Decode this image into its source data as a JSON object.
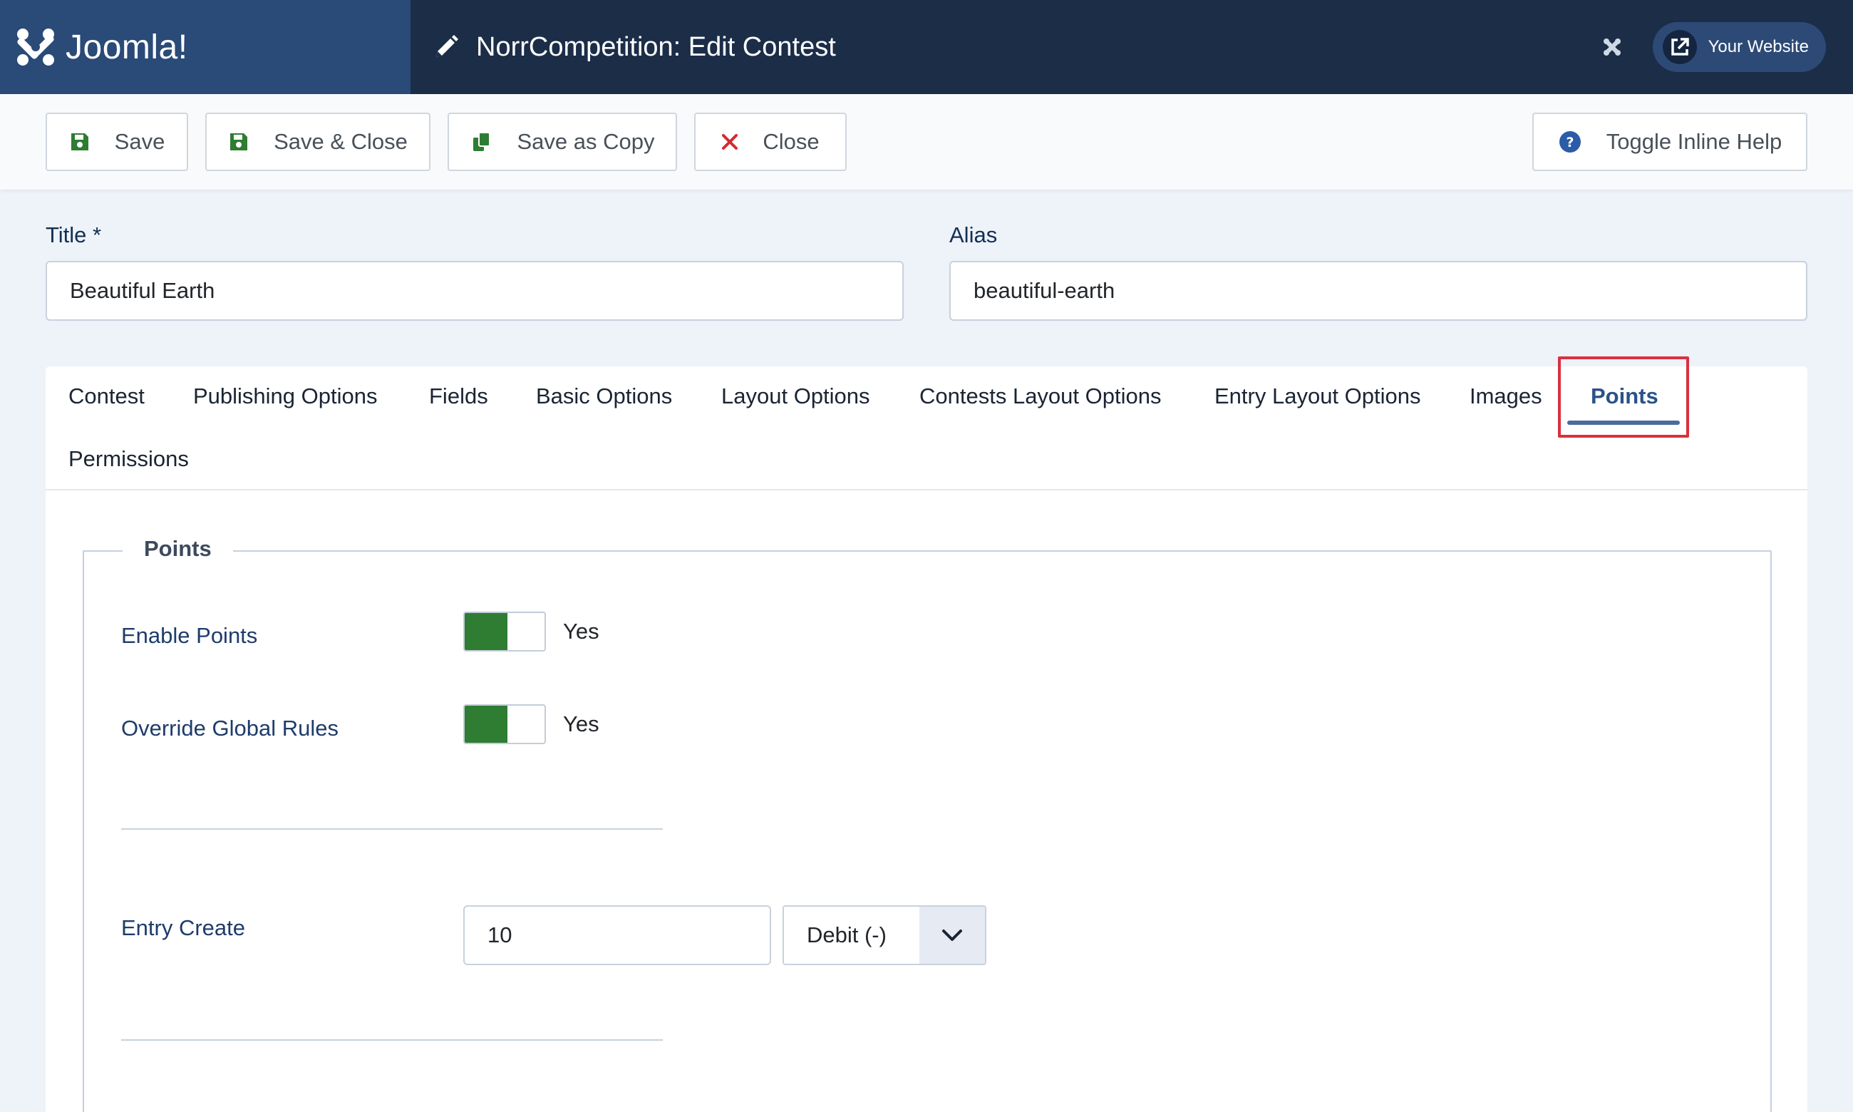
{
  "header": {
    "logo_text": "Joomla!",
    "page_title": "NorrCompetition: Edit Contest",
    "site_button_label": "Your Website"
  },
  "toolbar": {
    "save_label": "Save",
    "save_close_label": "Save & Close",
    "save_copy_label": "Save as Copy",
    "close_label": "Close",
    "help_label": "Toggle Inline Help"
  },
  "form": {
    "title_label": "Title *",
    "title_value": "Beautiful Earth",
    "alias_label": "Alias",
    "alias_value": "beautiful-earth"
  },
  "tabs": [
    {
      "label": "Contest"
    },
    {
      "label": "Publishing Options"
    },
    {
      "label": "Fields"
    },
    {
      "label": "Basic Options"
    },
    {
      "label": "Layout Options"
    },
    {
      "label": "Contests Layout Options"
    },
    {
      "label": "Entry Layout Options"
    },
    {
      "label": "Images"
    },
    {
      "label": "Points",
      "active": true
    },
    {
      "label": "Permissions"
    }
  ],
  "points": {
    "legend": "Points",
    "enable_points_label": "Enable Points",
    "enable_points_value": "Yes",
    "override_label": "Override Global Rules",
    "override_value": "Yes",
    "entry_create_label": "Entry Create",
    "entry_create_value": "10",
    "entry_create_type": "Debit (-)"
  },
  "colors": {
    "header_bg": "#1c2d48",
    "logo_bg": "#2a4a78",
    "toggle_on": "#2e7d32",
    "active_tab": "#2a5289",
    "highlight": "#d9303e"
  }
}
